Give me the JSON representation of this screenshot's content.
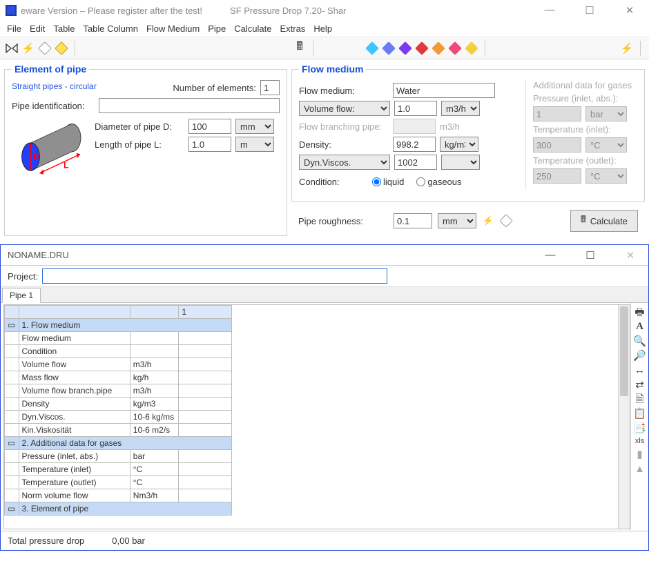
{
  "window": {
    "title_left": " eware Version – Please register after the test!",
    "title_right": "SF Pressure Drop 7.20- Shar"
  },
  "menubar": [
    "File",
    "Edit",
    "Table",
    "Table Column",
    "Flow Medium",
    "Pipe",
    "Calculate",
    "Extras",
    "Help"
  ],
  "toolbar_diamonds": [
    "#42c4ff",
    "#6a7cf0",
    "#7a3af0",
    "#e23a3a",
    "#f09a3a",
    "#f04a7a",
    "#f0d23a"
  ],
  "element_panel": {
    "legend": "Element of pipe",
    "subtype": "Straight pipes - circular",
    "number_label": "Number of elements:",
    "number_value": "1",
    "pipe_id_label": "Pipe identification:",
    "pipe_id_value": "",
    "diameter_label": "Diameter of pipe D:",
    "diameter_value": "100",
    "diameter_unit": "mm",
    "length_label": "Length of pipe L:",
    "length_value": "1.0",
    "length_unit": "m"
  },
  "flow_panel": {
    "legend": "Flow medium",
    "flow_medium_label": "Flow medium:",
    "flow_medium_value": "Water",
    "volume_flow_select": "Volume flow:",
    "volume_flow_value": "1.0",
    "volume_flow_unit": "m3/h",
    "branch_label": "Flow branching pipe:",
    "branch_value": "",
    "branch_unit": "m3/h",
    "density_label": "Density:",
    "density_value": "998.2",
    "density_unit": "kg/m3",
    "visc_select": "Dyn.Viscos.",
    "visc_value": "1002",
    "condition_label": "Condition:",
    "condition_liquid": "liquid",
    "condition_gaseous": "gaseous"
  },
  "gas_panel": {
    "header": "Additional data for gases",
    "pressure_label": "Pressure (inlet, abs.):",
    "pressure_value": "1",
    "pressure_unit": "bar",
    "temp_in_label": "Temperature (inlet):",
    "temp_in_value": "300",
    "temp_in_unit": "°C",
    "temp_out_label": "Temperature (outlet):",
    "temp_out_value": "250",
    "temp_out_unit": "°C"
  },
  "roughness": {
    "label": "Pipe roughness:",
    "value": "0.1",
    "unit": "mm",
    "calc_label": "Calculate"
  },
  "sub_window": {
    "title": "NONAME.DRU",
    "project_label": "Project:",
    "project_value": "",
    "tab": "Pipe 1",
    "col1_header": "1",
    "sections": {
      "s1": "1. Flow medium",
      "s2": "2. Additional data for gases",
      "s3": "3. Element of pipe"
    },
    "rows": [
      {
        "a": "Flow medium",
        "b": ""
      },
      {
        "a": "Condition",
        "b": ""
      },
      {
        "a": "Volume flow",
        "b": "m3/h"
      },
      {
        "a": "Mass flow",
        "b": "kg/h"
      },
      {
        "a": "Volume flow branch.pipe",
        "b": "m3/h"
      },
      {
        "a": "Density",
        "b": "kg/m3"
      },
      {
        "a": "Dyn.Viscos.",
        "b": "10-6 kg/ms"
      },
      {
        "a": "Kin.Viskosität",
        "b": "10-6 m2/s"
      }
    ],
    "rows2": [
      {
        "a": "Pressure (inlet, abs.)",
        "b": "bar"
      },
      {
        "a": "Temperature (inlet)",
        "b": "°C"
      },
      {
        "a": "Temperature (outlet)",
        "b": "°C"
      },
      {
        "a": "Norm volume flow",
        "b": "Nm3/h"
      }
    ]
  },
  "side_icons_labels": [
    "print",
    "font",
    "zoom-in",
    "zoom-out",
    "fit-width",
    "swap",
    "page",
    "copy",
    "copy-all",
    "xls",
    "collapse",
    "up"
  ],
  "status": {
    "label": "Total pressure drop",
    "value": "0,00 bar"
  }
}
